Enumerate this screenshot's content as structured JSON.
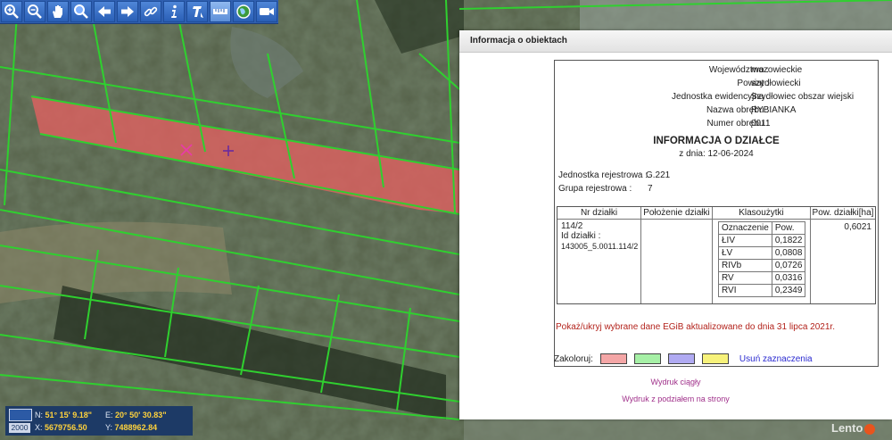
{
  "panel": {
    "title": "Informacja o obiektach",
    "wojewodztwo_label": "Województwo :",
    "wojewodztwo": "mazowieckie",
    "powiat_label": "Powiat :",
    "powiat": "szydłowiecki",
    "jednostka_label": "Jednostka ewidencyjna :",
    "jednostka": "Szydłowiec obszar wiejski",
    "obreb_label": "Nazwa obrębu :",
    "obreb": "RYBIANKA",
    "nr_obrebu_label": "Numer obrębu :",
    "nr_obrebu": "0011",
    "heading": "INFORMACJA O DZIAŁCE",
    "date": "z dnia: 12-06-2024",
    "jr_label": "Jednostka rejestrowa :",
    "jr": "G.221",
    "gr_label": "Grupa rejestrowa :",
    "gr": "7",
    "table": {
      "headers": [
        "Nr działki",
        "Położenie działki",
        "Klasoużytki",
        "Pow. działki[ha]"
      ],
      "nr_dzialki": "114/2",
      "id_label": "Id działki :",
      "id": "143005_5.0011.114/2",
      "pow_dzialki": "0,6021",
      "kl_headers": [
        "Oznaczenie",
        "Pow."
      ],
      "kl_rows": [
        [
          "ŁIV",
          "0,1822"
        ],
        [
          "ŁV",
          "0,0808"
        ],
        [
          "RIVb",
          "0,0726"
        ],
        [
          "RV",
          "0,0316"
        ],
        [
          "RVI",
          "0,2349"
        ]
      ]
    },
    "notice": "Pokaż/ukryj wybrane dane EGiB aktualizowane do dnia 31 lipca 2021r.",
    "zakoloruj": "Zakoloruj:",
    "swatches": [
      "#f4a6a6",
      "#a6f0a6",
      "#b0aaf2",
      "#f7f27a"
    ],
    "clear": "Usuń zaznaczenia",
    "print1": "Wydruk ciągły",
    "print2": "Wydruk z podziałem na strony"
  },
  "coords": {
    "scale": "2000",
    "n_label": "N:",
    "n": "51° 15' 9.18\"",
    "e_label": "E:",
    "e": "20° 50' 30.83\"",
    "x_label": "X:",
    "x": "5679756.50",
    "y_label": "Y:",
    "y": "7488962.84"
  },
  "toolbar": [
    "zoom-in-icon",
    "zoom-out-icon",
    "pan-hand-icon",
    "zoom-rect-icon",
    "back-arrow-icon",
    "forward-arrow-icon",
    "link-icon",
    "info-icon",
    "info-query-icon",
    "measure-icon",
    "globe-icon",
    "video-icon"
  ],
  "watermark": "Lento"
}
